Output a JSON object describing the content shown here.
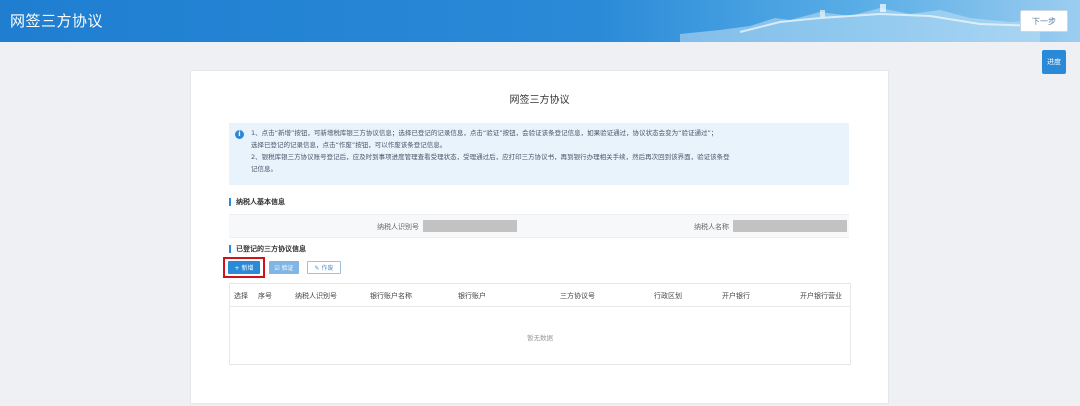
{
  "header": {
    "title": "网签三方协议",
    "next_label": "下一步"
  },
  "side": {
    "progress_label": "进度"
  },
  "main": {
    "title": "网签三方协议",
    "notice": {
      "line1": "1、点击“新增”按钮，可新增税库银三方协议信息；选择已登记的记录信息，点击“验证”按钮，会验证该条登记信息，如果验证通过，协议状态会变为“验证通过”；",
      "line2": "选择已登记的记录信息，点击“作废”按钮，可以作废该条登记信息。",
      "line3": "2、银税库银三方协议账号登记后，应及时到事项进度管理查看受理状态，受理通过后，应打印三方协议书，再到银行办理相关手续，然后再次回到该界面，验证该条登",
      "line4": "记信息。"
    },
    "basic_info": {
      "section_title": "纳税人基本信息",
      "taxpayer_id_label": "纳税人识别号",
      "taxpayer_name_label": "纳税人名称"
    },
    "registered": {
      "section_title": "已登记的三方协议信息",
      "add_label": "+ 新增",
      "verify_label": "☑ 验证",
      "void_label": "✎ 作废"
    },
    "table": {
      "columns": [
        "选择",
        "序号",
        "纳税人识别号",
        "银行账户名称",
        "银行账户",
        "三方协议号",
        "行政区划",
        "开户银行",
        "开户银行营业"
      ],
      "empty_text": "暂无数据"
    }
  },
  "colors": {
    "brand": "#2a8ad8",
    "highlight": "#d0121b"
  }
}
